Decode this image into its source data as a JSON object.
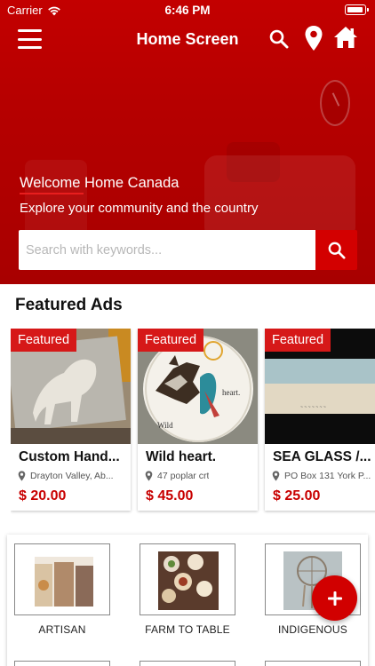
{
  "status_bar": {
    "carrier": "Carrier",
    "time": "6:46 PM"
  },
  "nav": {
    "title": "Home Screen"
  },
  "hero": {
    "welcome": "Welcome Home Canada",
    "subtitle": "Explore your community and the country",
    "search_placeholder": "Search with keywords..."
  },
  "featured": {
    "heading": "Featured Ads",
    "badge": "Featured",
    "items": [
      {
        "title": "Custom Hand...",
        "location": "Drayton Valley, Ab...",
        "price": "$ 20.00"
      },
      {
        "title": "Wild heart.",
        "location": "47 poplar crt",
        "price": "$ 45.00"
      },
      {
        "title": "SEA GLASS /...",
        "location": "PO Box 131 York P...",
        "price": "$ 25.00"
      }
    ]
  },
  "categories": [
    {
      "label": "ARTISAN"
    },
    {
      "label": "FARM TO TABLE"
    },
    {
      "label": "INDIGENOUS"
    }
  ],
  "colors": {
    "brand_red": "#d10000",
    "price_red": "#c80000",
    "badge_red": "#d61818"
  },
  "icons": [
    "menu-icon",
    "search-icon",
    "location-pin-icon",
    "home-icon",
    "wifi-icon",
    "battery-icon",
    "add-icon"
  ]
}
